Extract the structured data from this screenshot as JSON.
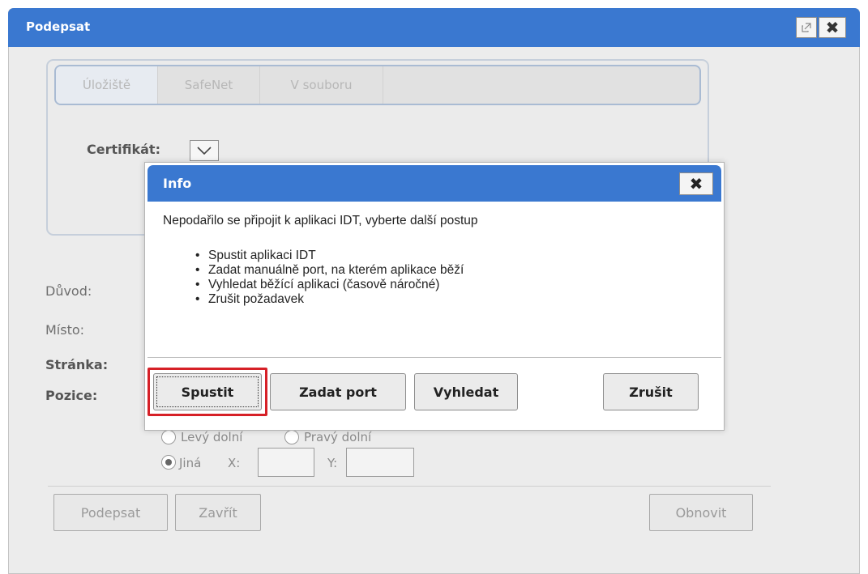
{
  "window": {
    "title": "Podepsat",
    "popout_icon": "popout-icon",
    "close_icon": "close-icon",
    "close_glyph": "✖"
  },
  "cert_panel": {
    "tabs": [
      "Úložiště",
      "SafeNet",
      "V souboru"
    ],
    "certificate_label": "Certifikát:",
    "certificate_value": ""
  },
  "form": {
    "reason_label": "Důvod:",
    "place_label": "Místo:",
    "page_label": "Stránka:",
    "position_label": "Pozice:",
    "position_options": [
      "Levý dolní",
      "Pravý dolní",
      "Jiná"
    ],
    "selected_position": "Jiná",
    "x_label": "X:",
    "y_label": "Y:",
    "x_value": "",
    "y_value": ""
  },
  "footer": {
    "sign_label": "Podepsat",
    "close_label": "Zavřít",
    "refresh_label": "Obnovit"
  },
  "info_dialog": {
    "title": "Info",
    "close_glyph": "✖",
    "message": "Nepodařilo se připojit k aplikaci IDT, vyberte další postup",
    "options": [
      "Spustit aplikaci IDT",
      "Zadat manuálně port, na kterém aplikace běží",
      "Vyhledat běžící aplikaci (časově náročné)",
      "Zrušit požadavek"
    ],
    "buttons": {
      "start": "Spustit",
      "enter_port": "Zadat port",
      "search": "Vyhledat",
      "cancel": "Zrušit"
    },
    "highlight_color": "#d62027"
  },
  "colors": {
    "titlebar": "#3a78d0",
    "disabled_text": "#9a9a9a"
  }
}
